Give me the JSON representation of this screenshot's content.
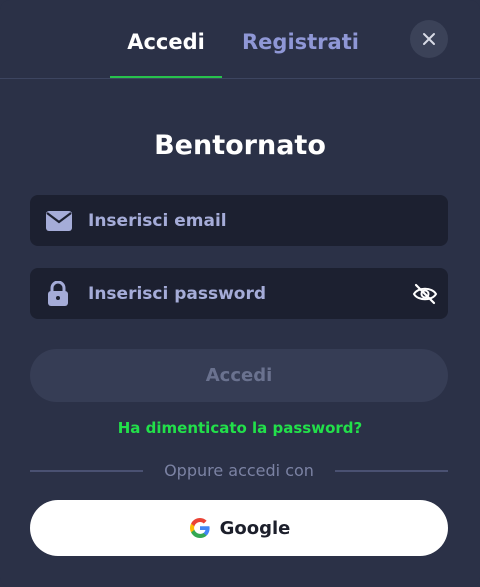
{
  "tabs": [
    {
      "label": "Accedi",
      "active": true
    },
    {
      "label": "Registrati",
      "active": false
    }
  ],
  "title": "Bentornato",
  "email": {
    "placeholder": "Inserisci email",
    "value": "",
    "icon": "envelope-icon"
  },
  "password": {
    "placeholder": "Inserisci password",
    "value": "",
    "icon": "lock-icon",
    "toggle_icon": "eye-off-icon"
  },
  "submit_label": "Accedi",
  "forgot_label": "Ha dimenticato la password?",
  "divider_text": "Oppure accedi con",
  "google_label": "Google",
  "colors": {
    "background": "#2b3147",
    "field": "#1c2030",
    "accent_green": "#22e04a",
    "tab_inactive": "#8f97d6",
    "disabled_button": "#363d55"
  }
}
